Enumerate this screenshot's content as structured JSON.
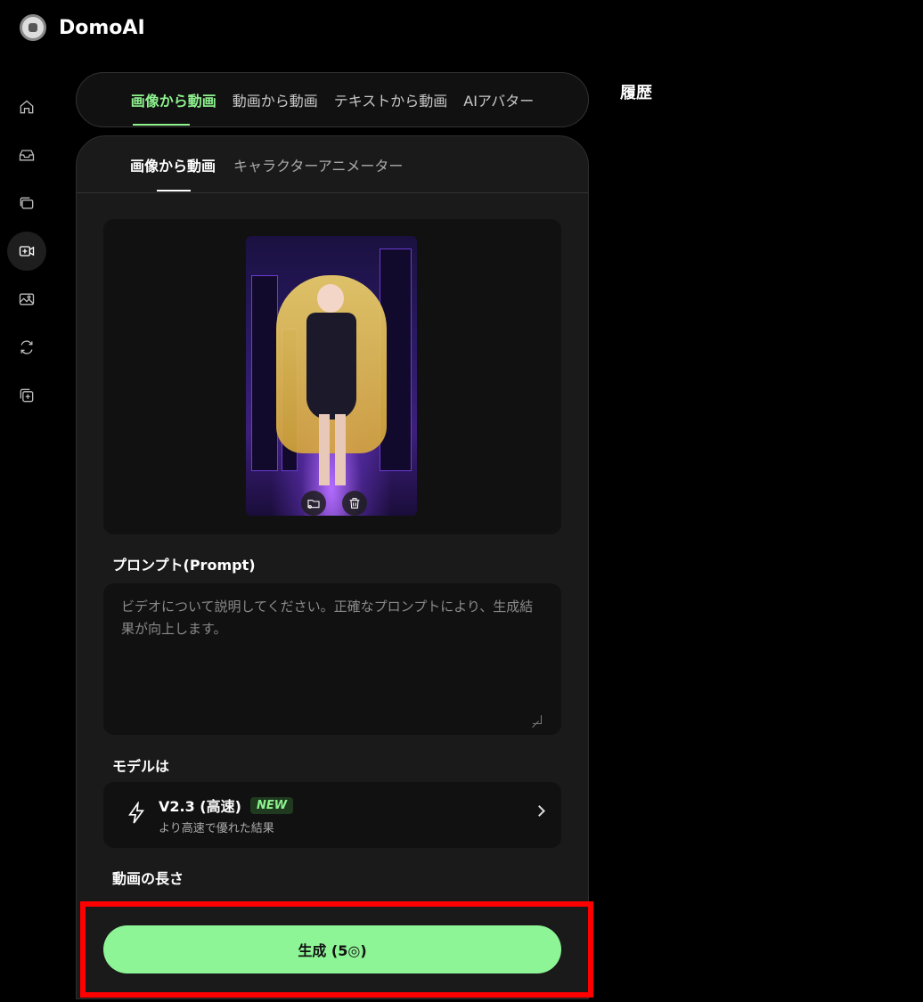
{
  "app": {
    "title": "DomoAI"
  },
  "sidebar": {
    "items": [
      {
        "name": "home",
        "icon": "home-icon"
      },
      {
        "name": "inbox",
        "icon": "inbox-icon"
      },
      {
        "name": "gallery",
        "icon": "gallery-icon"
      },
      {
        "name": "video",
        "icon": "video-add-icon",
        "active": true
      },
      {
        "name": "image",
        "icon": "image-icon"
      },
      {
        "name": "convert",
        "icon": "convert-icon"
      },
      {
        "name": "add",
        "icon": "add-layer-icon"
      }
    ]
  },
  "top_tabs": [
    {
      "label": "画像から動画",
      "active": true
    },
    {
      "label": "動画から動画"
    },
    {
      "label": "テキストから動画"
    },
    {
      "label": "AIアバター"
    }
  ],
  "history": {
    "label": "履歴"
  },
  "sub_tabs": [
    {
      "label": "画像から動画",
      "active": true
    },
    {
      "label": "キャラクターアニメーター"
    }
  ],
  "upload": {
    "change_icon": "folder-icon",
    "delete_icon": "trash-icon"
  },
  "prompt": {
    "label": "プロンプト(Prompt)",
    "placeholder": "ビデオについて説明してください。正確なプロンプトにより、生成結果が向上します。",
    "value": ""
  },
  "model": {
    "label": "モデルは",
    "name": "V2.3 (高速)",
    "badge": "NEW",
    "description": "より高速で優れた結果"
  },
  "duration": {
    "label": "動画の長さ"
  },
  "generate": {
    "label": "生成 (5◎)"
  },
  "colors": {
    "accent": "#8ef596",
    "highlight": "#ff0000",
    "panel": "#1a1a1a"
  }
}
